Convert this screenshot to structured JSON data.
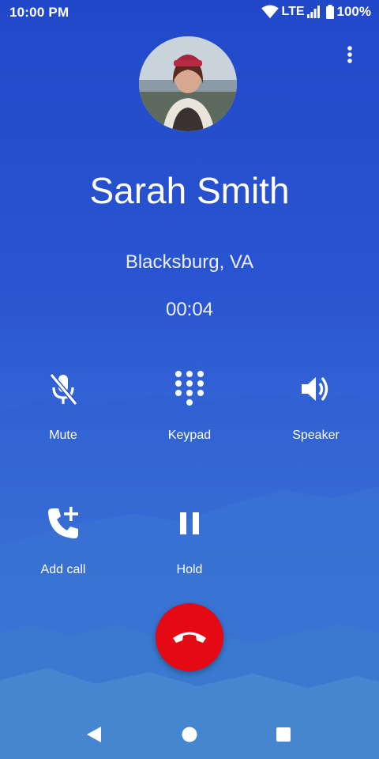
{
  "status_bar": {
    "time": "10:00 PM",
    "network": "LTE",
    "battery": "100%"
  },
  "contact": {
    "name": "Sarah Smith",
    "location": "Blacksburg, VA",
    "avatar_icon": "contact-photo"
  },
  "call": {
    "timer": "00:04"
  },
  "actions": {
    "mute": "Mute",
    "keypad": "Keypad",
    "speaker": "Speaker",
    "add_call": "Add call",
    "hold": "Hold"
  },
  "colors": {
    "background_top": "#2148c9",
    "background_bottom": "#4a8ad6",
    "end_call": "#e50914"
  },
  "icons": {
    "more": "more-vert-icon",
    "mute": "mic-off-icon",
    "keypad": "dialpad-icon",
    "speaker": "volume-up-icon",
    "add_call": "add-call-icon",
    "hold": "pause-icon",
    "end_call": "call-end-icon",
    "back": "back-triangle-icon",
    "home": "home-circle-icon",
    "recents": "recents-square-icon"
  }
}
